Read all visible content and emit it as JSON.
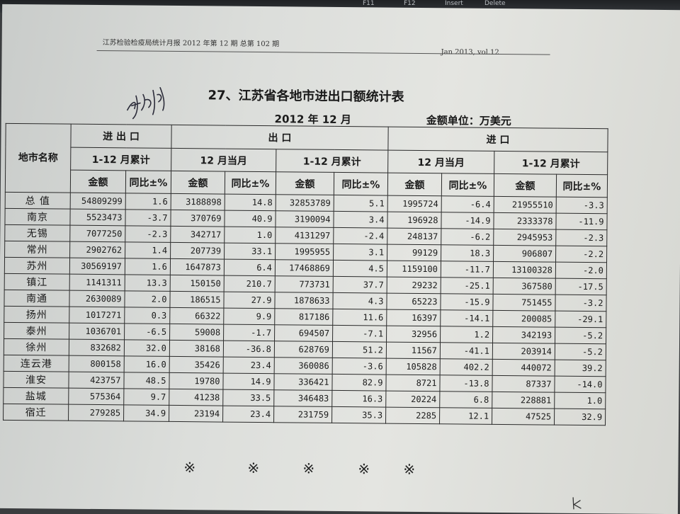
{
  "keyboard": {
    "keys": [
      "F11",
      "F12",
      "Insert",
      "Delete"
    ]
  },
  "page": {
    "header_left": "江苏检验检疫局统计月报 2012 年第 12 期 总第 102 期",
    "header_right": "Jan 2013, vol.12",
    "title": "27、江苏省各地市进出口额统计表",
    "period": "2012 年 12 月",
    "unit": "金额单位：万美元",
    "handwriting": "苏州"
  },
  "table": {
    "header": {
      "city_col": "地市名称",
      "groups": [
        "进 出 口",
        "出 口",
        "进 口"
      ],
      "periods": [
        "1-12 月累计",
        "12 月当月",
        "1-12 月累计",
        "12 月当月",
        "1-12 月累计"
      ],
      "amount": "金额",
      "yoy": "同比±%"
    },
    "rows": [
      {
        "city": "总 值",
        "v": [
          "54809299",
          "1.6",
          "3188898",
          "14.8",
          "32853789",
          "5.1",
          "1995724",
          "-6.4",
          "21955510",
          "-3.3"
        ]
      },
      {
        "city": "南京",
        "v": [
          "5523473",
          "-3.7",
          "370769",
          "40.9",
          "3190094",
          "3.4",
          "196928",
          "-14.9",
          "2333378",
          "-11.9"
        ]
      },
      {
        "city": "无锡",
        "v": [
          "7077250",
          "-2.3",
          "342717",
          "1.0",
          "4131297",
          "-2.4",
          "248137",
          "-6.2",
          "2945953",
          "-2.3"
        ]
      },
      {
        "city": "常州",
        "v": [
          "2902762",
          "1.4",
          "207739",
          "33.1",
          "1995955",
          "3.1",
          "99129",
          "18.3",
          "906807",
          "-2.2"
        ]
      },
      {
        "city": "苏州",
        "v": [
          "30569197",
          "1.6",
          "1647873",
          "6.4",
          "17468869",
          "4.5",
          "1159100",
          "-11.7",
          "13100328",
          "-2.0"
        ]
      },
      {
        "city": "镇江",
        "v": [
          "1141311",
          "13.3",
          "150150",
          "210.7",
          "773731",
          "37.7",
          "29232",
          "-25.1",
          "367580",
          "-17.5"
        ]
      },
      {
        "city": "南通",
        "v": [
          "2630089",
          "2.0",
          "186515",
          "27.9",
          "1878633",
          "4.3",
          "65223",
          "-15.9",
          "751455",
          "-3.2"
        ]
      },
      {
        "city": "扬州",
        "v": [
          "1017271",
          "0.3",
          "66322",
          "9.9",
          "817186",
          "11.6",
          "16397",
          "-14.1",
          "200085",
          "-29.1"
        ]
      },
      {
        "city": "泰州",
        "v": [
          "1036701",
          "-6.5",
          "59008",
          "-1.7",
          "694507",
          "-7.1",
          "32956",
          "1.2",
          "342193",
          "-5.2"
        ]
      },
      {
        "city": "徐州",
        "v": [
          "832682",
          "32.0",
          "38168",
          "-36.8",
          "628769",
          "51.2",
          "11567",
          "-41.1",
          "203914",
          "-5.2"
        ]
      },
      {
        "city": "连云港",
        "v": [
          "800158",
          "16.0",
          "35426",
          "23.4",
          "360086",
          "-3.6",
          "105828",
          "402.2",
          "440072",
          "39.2"
        ]
      },
      {
        "city": "淮安",
        "v": [
          "423757",
          "48.5",
          "19780",
          "14.9",
          "336421",
          "82.9",
          "8721",
          "-13.8",
          "87337",
          "-14.0"
        ]
      },
      {
        "city": "盐城",
        "v": [
          "575364",
          "9.7",
          "41238",
          "33.5",
          "346483",
          "16.3",
          "20224",
          "6.8",
          "228881",
          "1.0"
        ]
      },
      {
        "city": "宿迁",
        "v": [
          "279285",
          "34.9",
          "23194",
          "23.4",
          "231759",
          "35.3",
          "2285",
          "12.1",
          "47525",
          "32.9"
        ]
      }
    ]
  },
  "footer": {
    "marks": [
      "※",
      "※",
      "※",
      "※",
      "※"
    ],
    "pen_mark": "k"
  }
}
